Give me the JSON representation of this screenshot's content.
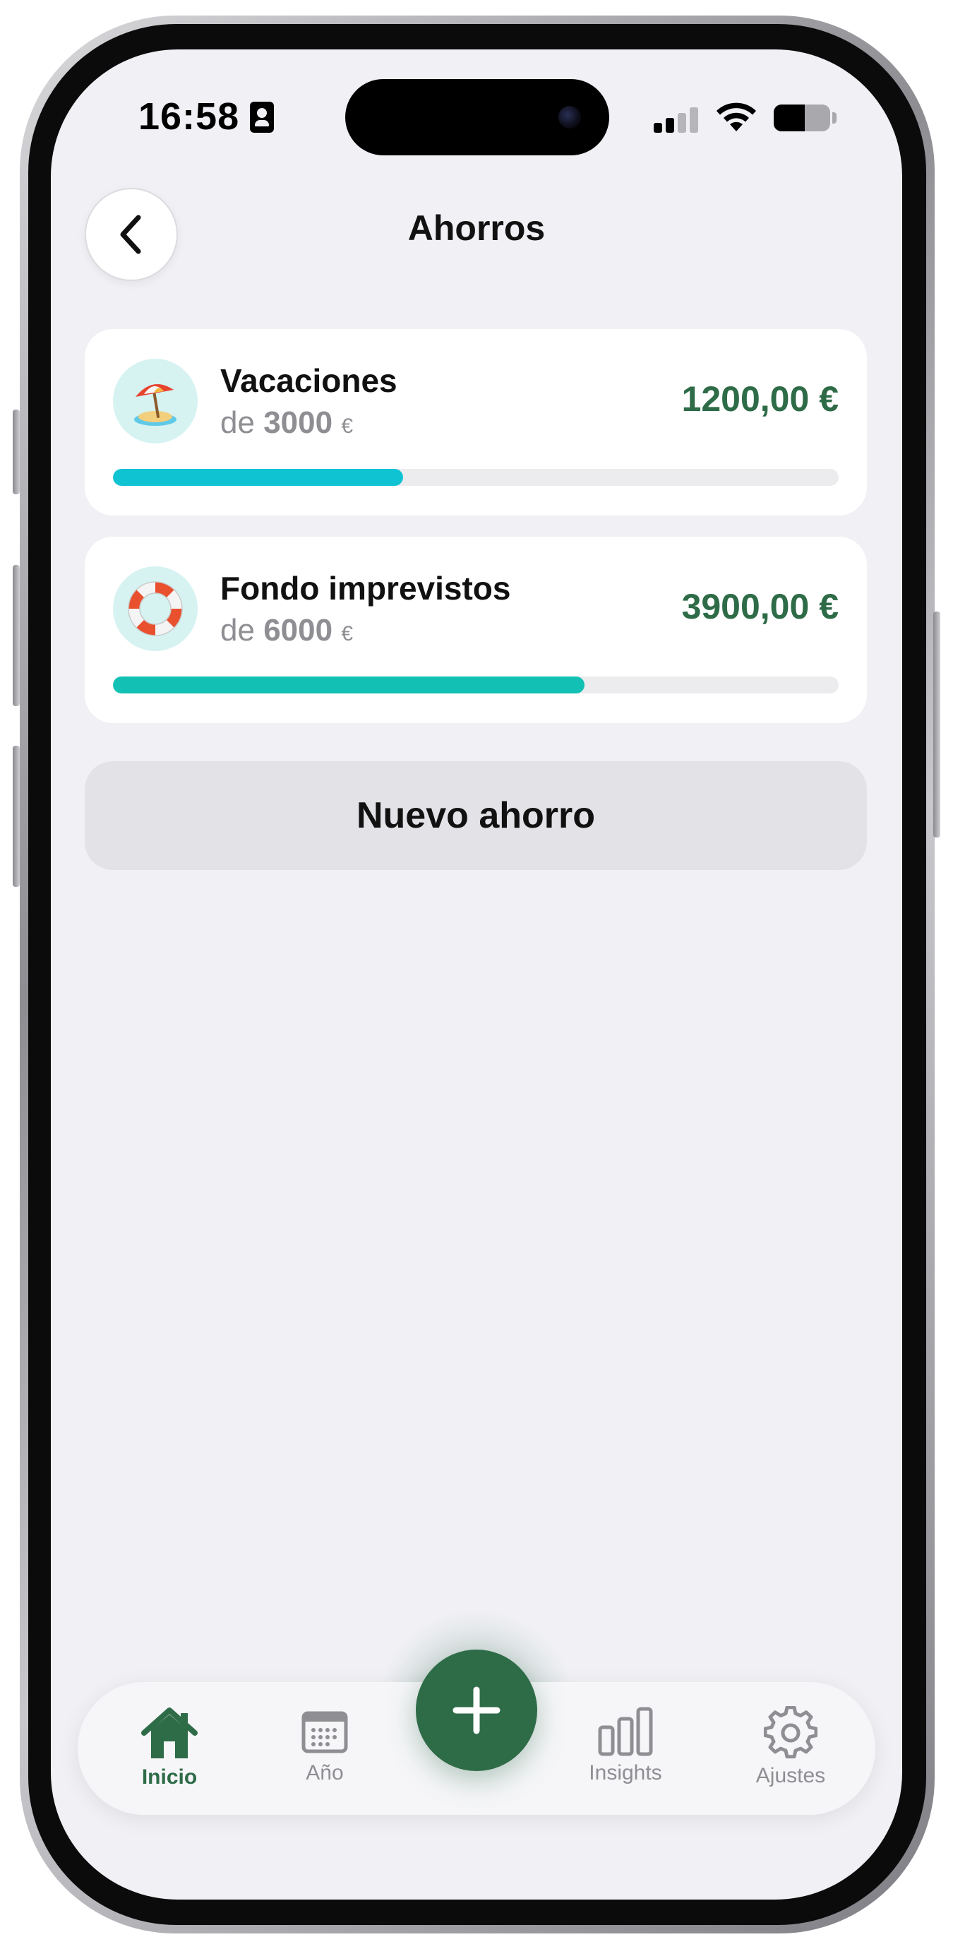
{
  "status_bar": {
    "time": "16:58",
    "battery_level": 0.55,
    "signal_bars": 2
  },
  "header": {
    "title": "Ahorros",
    "back_icon": "chevron-left-icon"
  },
  "savings": [
    {
      "emoji": "🏝️",
      "icon": "desert-island-emoji",
      "name": "Vacaciones",
      "target_prefix": "de",
      "target": "3000",
      "currency": "€",
      "amount": "1200,00 €",
      "progress": 0.4,
      "bar_color": "#10c3d3"
    },
    {
      "emoji": "🛟",
      "icon": "ring-buoy-emoji",
      "name": "Fondo imprevistos",
      "target_prefix": "de",
      "target": "6000",
      "currency": "€",
      "amount": "3900,00 €",
      "progress": 0.65,
      "bar_color": "#12c1b3"
    }
  ],
  "new_saving_button": "Nuevo ahorro",
  "tabbar": {
    "items": [
      {
        "label": "Inicio",
        "icon": "home-icon",
        "active": true
      },
      {
        "label": "Año",
        "icon": "calendar-icon",
        "active": false
      },
      {
        "label": "Insights",
        "icon": "bar-chart-icon",
        "active": false
      },
      {
        "label": "Ajustes",
        "icon": "gear-icon",
        "active": false
      }
    ],
    "fab_icon": "plus-icon"
  },
  "colors": {
    "accent": "#2e6b47",
    "background": "#f0f0f5",
    "card": "#ffffff",
    "muted_text": "#8e8e93"
  }
}
